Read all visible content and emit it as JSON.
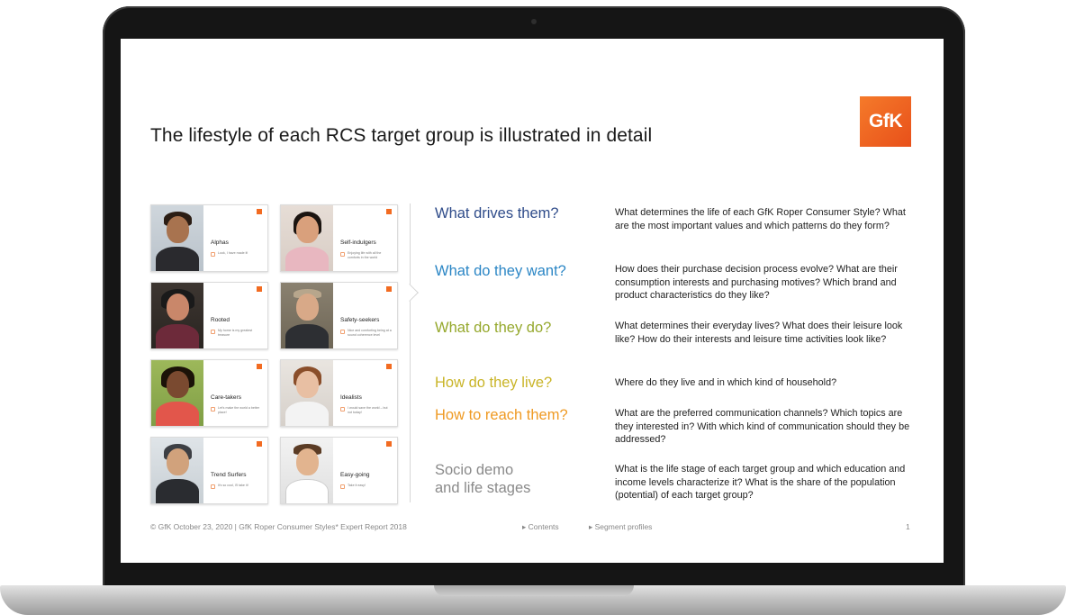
{
  "slide": {
    "title": "The lifestyle of each RCS target group is illustrated in detail",
    "logo_text": "GfK",
    "colors": {
      "brand": "#f26b21",
      "q1": "#2f4c8a",
      "q2": "#2b86c5",
      "q3": "#95a82c",
      "q4": "#c9b427",
      "q5": "#ef9a23",
      "q6": "#8a8a8a"
    }
  },
  "cards": [
    {
      "label": "Alphas",
      "note": "Look, I have made it!",
      "icon": "person-photo"
    },
    {
      "label": "Self-indulgers",
      "note": "Enjoying life with all the comforts in the world",
      "icon": "person-photo"
    },
    {
      "label": "Rooted",
      "note": "My home is my greatest treasure",
      "icon": "person-photo"
    },
    {
      "label": "Safety-seekers",
      "note": "Nice and comforting being at a sound coherence level",
      "icon": "person-photo"
    },
    {
      "label": "Care-takers",
      "note": "Let's make the world a better place!",
      "icon": "person-photo"
    },
    {
      "label": "Idealists",
      "note": "I would save the world – but not today!",
      "icon": "person-photo"
    },
    {
      "label": "Trend Surfers",
      "note": "It's so cool, I'll take it!",
      "icon": "person-photo"
    },
    {
      "label": "Easy-going",
      "note": "Take it easy!",
      "icon": "person-photo"
    }
  ],
  "questions": [
    {
      "title": "What drives them?",
      "desc": "What determines the life of each GfK Roper Consumer Style? What are the most important values and which patterns do they form?"
    },
    {
      "title": "What do they want?",
      "desc": "How does their purchase decision process evolve? What are their consumption interests and purchasing motives? Which brand and product characteristics do they like?"
    },
    {
      "title": "What do they do?",
      "desc": "What determines their everyday lives? What does their leisure look like? How do their interests and leisure time activities look like?"
    },
    {
      "title": "How do they live?",
      "desc": "Where do they live and in which kind of household?"
    },
    {
      "title": "How to reach them?",
      "desc": "What are the preferred communication channels? Which topics are they interested in? With which kind of communication should they be addressed?"
    },
    {
      "title": "Socio demo\nand life stages",
      "desc": "What is the life stage of each target group and which education and income levels characterize it? What is the share of the population (potential) of each target group?"
    }
  ],
  "footer": {
    "copyright": "© GfK October 23, 2020 | GfK Roper Consumer Styles* Expert Report 2018",
    "link_contents": "Contents",
    "link_segments": "Segment profiles",
    "page_number": "1"
  }
}
